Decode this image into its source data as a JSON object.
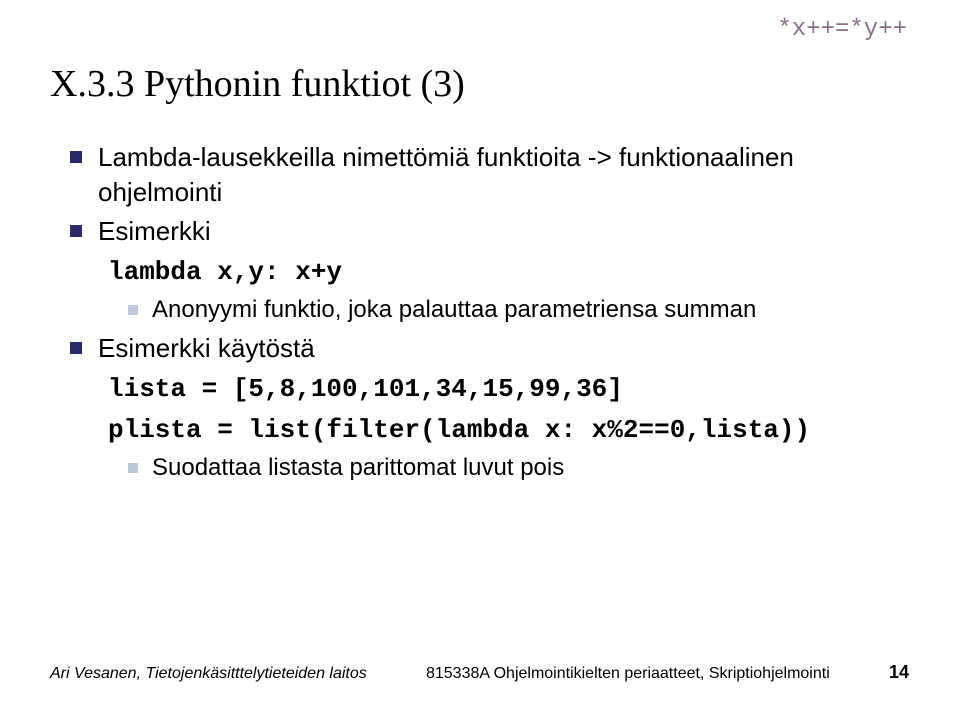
{
  "corner_code": "*x++=*y++",
  "title": "X.3.3 Pythonin funktiot (3)",
  "bullets": {
    "b1": "Lambda-lausekkeilla nimettömiä funktioita -> funktionaalinen ohjelmointi",
    "b2": "Esimerkki",
    "code1": "lambda x,y: x+y",
    "sub1": "Anonyymi funktio, joka palauttaa parametriensa summan",
    "b3": "Esimerkki käytöstä",
    "code2": "lista = [5,8,100,101,34,15,99,36]",
    "code3": "plista = list(filter(lambda x: x%2==0,lista))",
    "sub2": "Suodattaa listasta parittomat luvut pois"
  },
  "footer": {
    "left": "Ari Vesanen, Tietojenkäsitttelytieteiden laitos",
    "center": "815338A Ohjelmointikielten periaatteet, Skriptiohjelmointi",
    "page": "14"
  }
}
